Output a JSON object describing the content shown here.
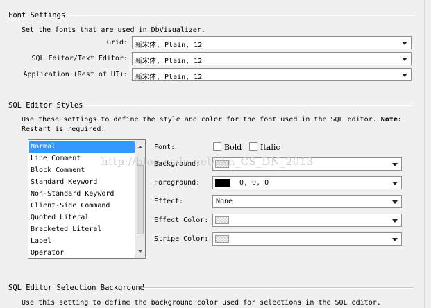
{
  "font_settings": {
    "title": "Font Settings",
    "description": "Set the fonts that are used in DbVisualizer.",
    "fields": [
      {
        "label": "Grid:",
        "value": "新宋体, Plain, 12"
      },
      {
        "label": "SQL Editor/Text Editor:",
        "value": "新宋体, Plain, 12"
      },
      {
        "label": "Application (Rest of UI):",
        "value": "新宋体, Plain, 12"
      }
    ]
  },
  "sql_editor_styles": {
    "title": "SQL Editor Styles",
    "description_line1": "Use these settings to define the style and color for the font used in the SQL editor.",
    "note_label": "Note:",
    "description_line2": "Restart is required.",
    "styles_list": [
      "Normal",
      "Line Comment",
      "Block Comment",
      "Standard Keyword",
      "Non-Standard Keyword",
      "Client-Side Command",
      "Quoted Literal",
      "Bracketed Literal",
      "Label",
      "Operator"
    ],
    "selected_style": "Normal",
    "font_label": "Font:",
    "bold_label": "Bold",
    "italic_label": "Italic",
    "bold_checked": false,
    "italic_checked": false,
    "background_label": "Background:",
    "foreground_label": "Foreground:",
    "foreground_value": "0, 0, 0",
    "foreground_color": "#000000",
    "effect_label": "Effect:",
    "effect_value": "None",
    "effect_color_label": "Effect Color:",
    "stripe_color_label": "Stripe Color:"
  },
  "selection_background": {
    "title": "SQL Editor Selection Background",
    "description": "Use this setting to define the background color used for selections in the SQL editor."
  },
  "watermark": "http://blog.csdn.net/zkn_CS_DN_2013",
  "colors": {
    "selection_highlight": "#3399ff",
    "panel_background": "#f0f0f0"
  }
}
